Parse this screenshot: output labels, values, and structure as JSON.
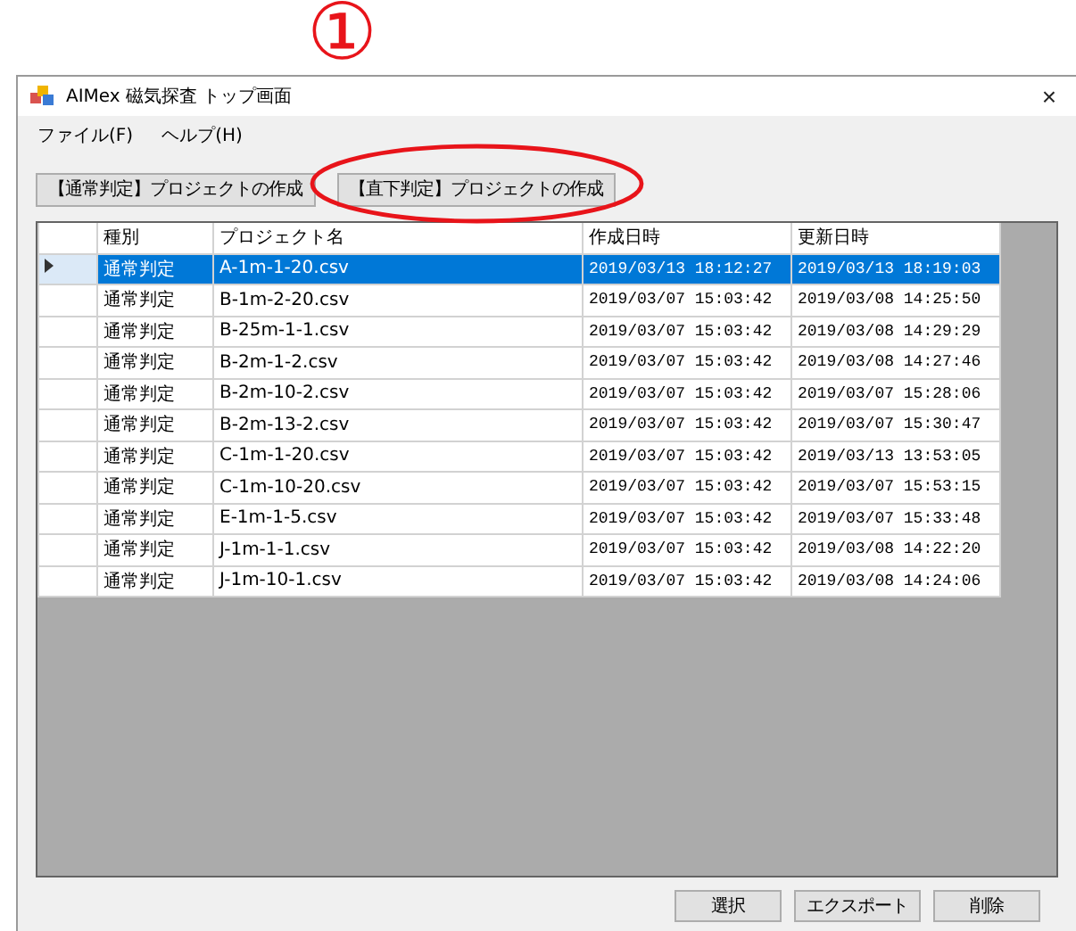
{
  "annotation": {
    "marker": "①"
  },
  "window": {
    "title": "AIMex 磁気探査 トップ画面",
    "close": "×"
  },
  "menu": [
    "ファイル(F)",
    "ヘルプ(H)"
  ],
  "toolbar": [
    {
      "label": "【通常判定】プロジェクトの作成",
      "highlighted": false
    },
    {
      "label": "【直下判定】プロジェクトの作成",
      "highlighted": true
    }
  ],
  "table": {
    "columns": [
      "種別",
      "プロジェクト名",
      "作成日時",
      "更新日時"
    ],
    "rows": [
      {
        "selected": true,
        "cells": [
          "通常判定",
          "A-1m-1-20.csv",
          "2019/03/13 18:12:27",
          "2019/03/13 18:19:03"
        ]
      },
      {
        "selected": false,
        "cells": [
          "通常判定",
          "B-1m-2-20.csv",
          "2019/03/07 15:03:42",
          "2019/03/08 14:25:50"
        ]
      },
      {
        "selected": false,
        "cells": [
          "通常判定",
          "B-25m-1-1.csv",
          "2019/03/07 15:03:42",
          "2019/03/08 14:29:29"
        ]
      },
      {
        "selected": false,
        "cells": [
          "通常判定",
          "B-2m-1-2.csv",
          "2019/03/07 15:03:42",
          "2019/03/08 14:27:46"
        ]
      },
      {
        "selected": false,
        "cells": [
          "通常判定",
          "B-2m-10-2.csv",
          "2019/03/07 15:03:42",
          "2019/03/07 15:28:06"
        ]
      },
      {
        "selected": false,
        "cells": [
          "通常判定",
          "B-2m-13-2.csv",
          "2019/03/07 15:03:42",
          "2019/03/07 15:30:47"
        ]
      },
      {
        "selected": false,
        "cells": [
          "通常判定",
          "C-1m-1-20.csv",
          "2019/03/07 15:03:42",
          "2019/03/13 13:53:05"
        ]
      },
      {
        "selected": false,
        "cells": [
          "通常判定",
          "C-1m-10-20.csv",
          "2019/03/07 15:03:42",
          "2019/03/07 15:53:15"
        ]
      },
      {
        "selected": false,
        "cells": [
          "通常判定",
          "E-1m-1-5.csv",
          "2019/03/07 15:03:42",
          "2019/03/07 15:33:48"
        ]
      },
      {
        "selected": false,
        "cells": [
          "通常判定",
          "J-1m-1-1.csv",
          "2019/03/07 15:03:42",
          "2019/03/08 14:22:20"
        ]
      },
      {
        "selected": false,
        "cells": [
          "通常判定",
          "J-1m-10-1.csv",
          "2019/03/07 15:03:42",
          "2019/03/08 14:24:06"
        ]
      }
    ]
  },
  "buttons": [
    "選択",
    "エクスポート",
    "削除"
  ]
}
